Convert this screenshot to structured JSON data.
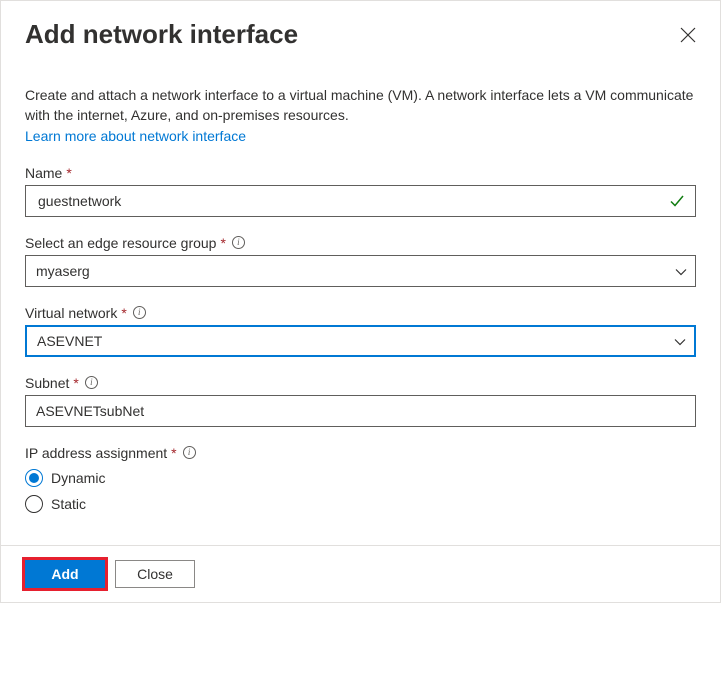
{
  "header": {
    "title": "Add network interface"
  },
  "intro": {
    "text": "Create and attach a network interface to a virtual machine (VM). A network interface lets a VM communicate with the internet, Azure, and on-premises resources.",
    "link": "Learn more about network interface"
  },
  "fields": {
    "name": {
      "label": "Name",
      "value": "guestnetwork"
    },
    "resource_group": {
      "label": "Select an edge resource group",
      "value": "myaserg"
    },
    "vnet": {
      "label": "Virtual network",
      "value": "ASEVNET"
    },
    "subnet": {
      "label": "Subnet",
      "value": "ASEVNETsubNet"
    },
    "ip_assignment": {
      "label": "IP address assignment",
      "options": {
        "dynamic": "Dynamic",
        "static": "Static"
      },
      "selected": "dynamic"
    }
  },
  "footer": {
    "add": "Add",
    "close": "Close"
  }
}
